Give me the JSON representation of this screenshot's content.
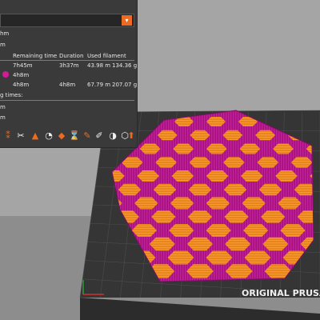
{
  "panel": {
    "rows_top": [
      "hm",
      "m"
    ],
    "headers": [
      "Remaining time",
      "Duration",
      "Used filament"
    ],
    "rows": [
      {
        "remaining": "7h45m",
        "duration": "3h37m",
        "filament_m": "43.98 m",
        "filament_g": "134.36 g"
      },
      {
        "remaining": "4h8m",
        "duration": "",
        "filament_m": "",
        "filament_g": ""
      },
      {
        "remaining": "4h8m",
        "duration": "4h8m",
        "filament_m": "67.79 m",
        "filament_g": "207.07 g"
      }
    ],
    "section_label": "g times:",
    "rows_bottom": [
      "m",
      "m"
    ],
    "swatch_color": "#d41a9b",
    "accent": "#ed6b21"
  },
  "toolbar": {
    "icons": [
      "layers-icon",
      "cut-icon",
      "paint-icon",
      "seam-icon",
      "color-icon",
      "hourglass-icon",
      "brush-icon",
      "measure-icon",
      "contrast-icon",
      "cube-icon",
      "bed-icon"
    ]
  },
  "bed": {
    "label": "ORIGINAL PRUSA",
    "colors": {
      "magenta": "#b4158b",
      "orange": "#f08a1e",
      "bed": "#343434",
      "grid": "#4a4a4a"
    }
  }
}
